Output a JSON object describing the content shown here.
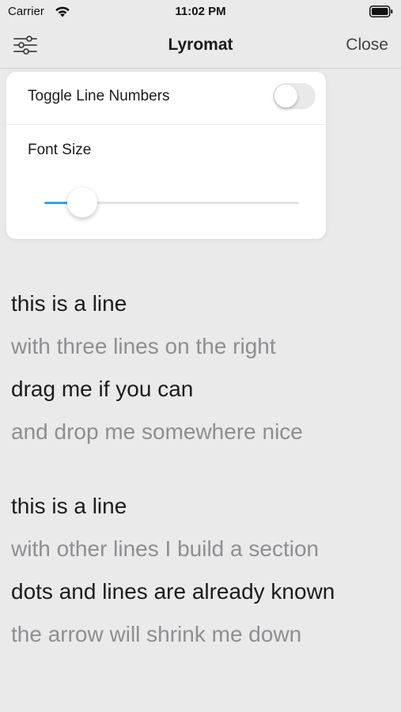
{
  "status_bar": {
    "carrier": "Carrier",
    "time": "11:02 PM",
    "wifi_icon": "wifi-icon",
    "battery_icon": "battery-full-icon"
  },
  "nav": {
    "title": "Lyromat",
    "close_label": "Close",
    "settings_icon": "sliders-icon"
  },
  "popover": {
    "toggle_label": "Toggle Line Numbers",
    "toggle_on": false,
    "font_size_label": "Font Size",
    "font_size_fraction": 0.15,
    "accent_color": "#37a2e8"
  },
  "lyrics": {
    "sections": [
      {
        "lines": [
          {
            "text": "this is a line",
            "style": "primary"
          },
          {
            "text": "with three lines on the right",
            "style": "secondary"
          },
          {
            "text": "drag me if you can",
            "style": "primary"
          },
          {
            "text": "and drop me somewhere nice",
            "style": "secondary"
          }
        ]
      },
      {
        "lines": [
          {
            "text": "this is a line",
            "style": "primary"
          },
          {
            "text": "with other lines I build a section",
            "style": "secondary"
          },
          {
            "text": "dots and lines are already known",
            "style": "primary"
          },
          {
            "text": "the arrow will shrink me down",
            "style": "secondary"
          }
        ]
      }
    ]
  }
}
